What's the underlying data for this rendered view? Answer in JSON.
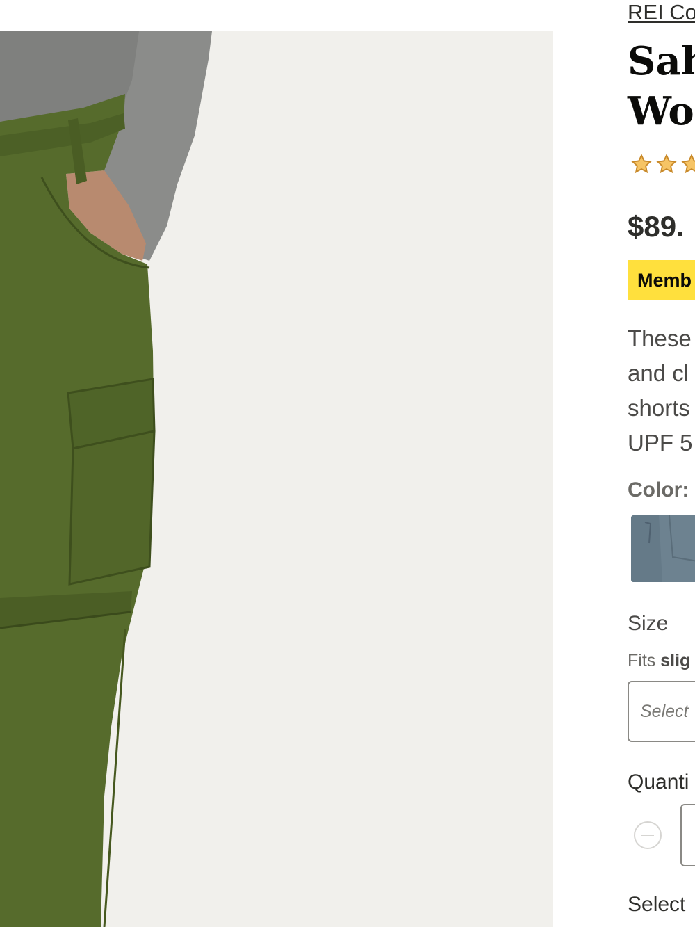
{
  "product": {
    "brand": "REI Co",
    "title_line1": "Sah",
    "title_line2": "Wo",
    "rating_stars_visible": 3,
    "price": "$89.",
    "member_badge": "Memb",
    "description_lines": [
      "These",
      "and cl",
      "shorts",
      "UPF 5"
    ]
  },
  "color": {
    "label": "Color:",
    "swatch_color": "#6d8290"
  },
  "size": {
    "label": "Size",
    "fit_prefix": "Fits ",
    "fit_bold": "slig",
    "select_placeholder": "Select"
  },
  "quantity": {
    "label": "Quanti",
    "minus_icon": "minus-circle-icon"
  },
  "footer": {
    "select_label": "Select"
  },
  "colors": {
    "pants": "#566b2c",
    "shirt": "#8b8c8a",
    "background": "#f1f0ec",
    "member_yellow": "#ffe03d",
    "star": "#e8a33d"
  }
}
